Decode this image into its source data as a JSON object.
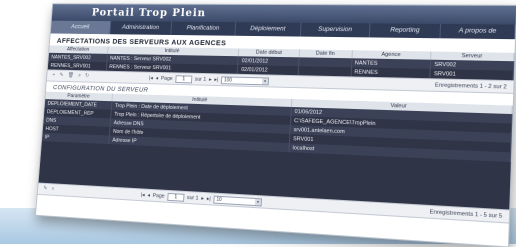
{
  "app": {
    "title": "Portail Trop Plein"
  },
  "nav": [
    {
      "label": "Accueil",
      "active": true
    },
    {
      "label": "Administration",
      "active": false
    },
    {
      "label": "Planification",
      "active": false
    },
    {
      "label": "Déploiement",
      "active": false
    },
    {
      "label": "Supervision",
      "active": false
    },
    {
      "label": "Reporting",
      "active": false
    },
    {
      "label": "A propos de",
      "active": false
    }
  ],
  "affectations": {
    "title": "AFFECTATIONS DES SERVEURS AUX AGENCES",
    "columns": [
      "Affectation",
      "Intitulé",
      "Date début",
      "Date fin",
      "Agence",
      "Serveur"
    ],
    "rows": [
      [
        "NANTES_SRV002",
        "NANTES : Serveur SRV002",
        "02/01/2012",
        "",
        "NANTES",
        "SRV002"
      ],
      [
        "RENNES_SRV001",
        "RENNES : Serveur SRV001",
        "02/01/2012",
        "",
        "RENNES",
        "SRV001"
      ]
    ],
    "pager": {
      "page_label": "Page",
      "page_value": "1",
      "of_label": "sur 1",
      "rows_value": "100",
      "records": "Enregistrements 1 - 2 sur 2"
    }
  },
  "config": {
    "title": "CONFIGURATION DU SERVEUR",
    "columns": [
      "Paramètre",
      "Intitulé",
      "Valeur"
    ],
    "rows": [
      [
        "DEPLOIEMENT_DATE",
        "Trop Plein : Date de déploiement",
        "01/06/2012"
      ],
      [
        "DEPLOIEMENT_REP",
        "Trop Plein : Répertoire de déploiement",
        "C:\\SAFEGE_AGENCE\\TropPlein"
      ],
      [
        "DNS",
        "Adresse DNS",
        "srv001.antelaen.com"
      ],
      [
        "HOST",
        "Nom de l'hôte",
        "SRV001"
      ],
      [
        "IP",
        "Adresse IP",
        "localhost"
      ]
    ],
    "pager": {
      "page_label": "Page",
      "page_value": "1",
      "of_label": "sur 1",
      "rows_value": "10",
      "records": "Enregistrements 1 - 5 sur 5"
    }
  }
}
